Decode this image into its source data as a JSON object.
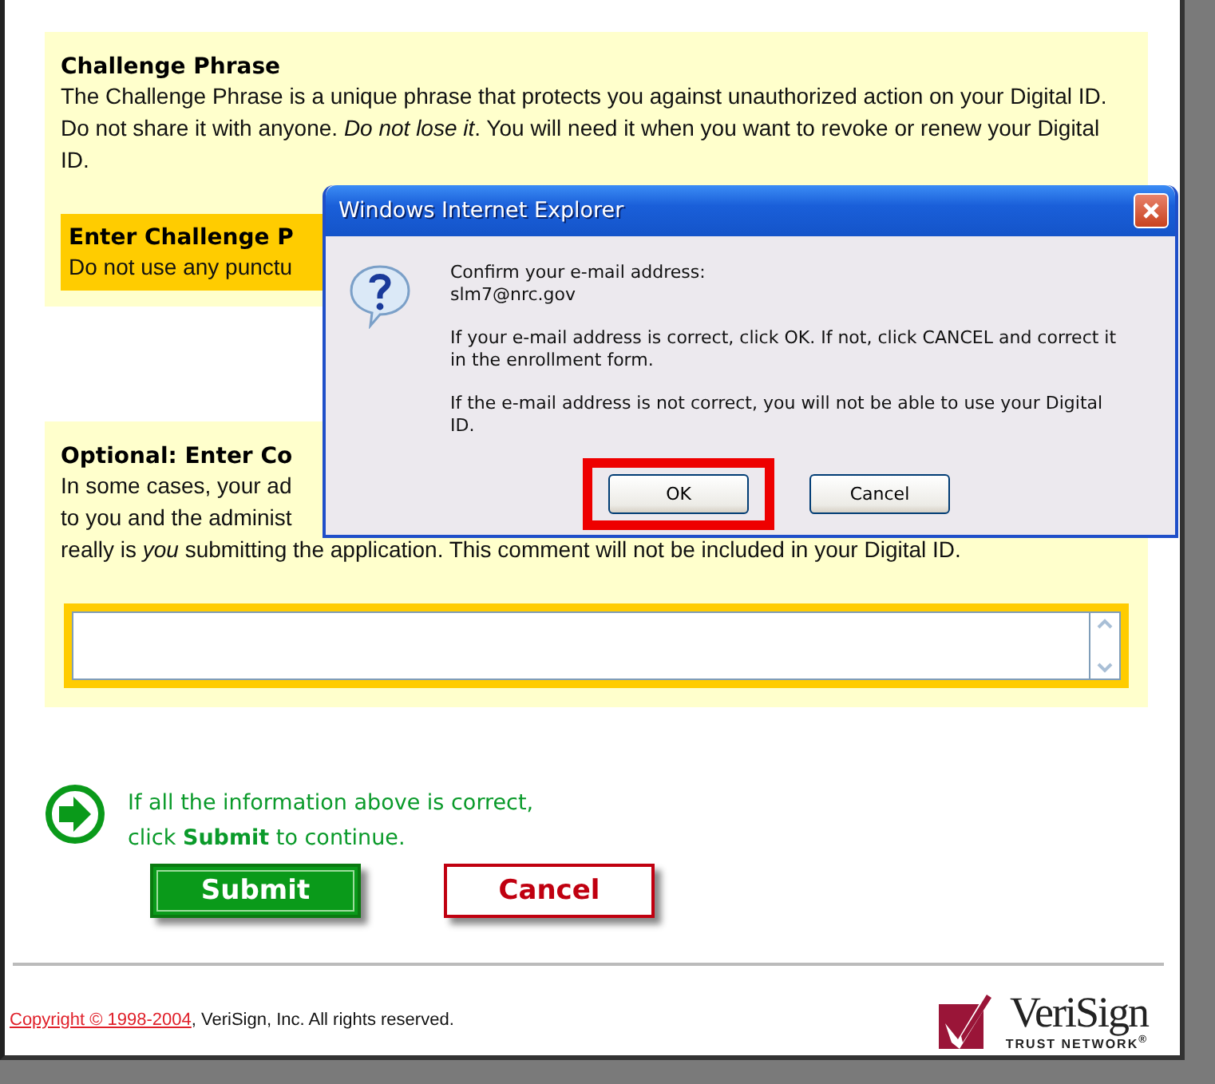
{
  "challenge": {
    "heading": "Challenge Phrase",
    "text": "The Challenge Phrase is a unique phrase that protects you against unauthorized action on your Digital ID. Do not share it with anyone. *Do not lose it*. You will need it when you want to revoke or renew your Digital ID.",
    "enter_heading": "Enter Challenge P",
    "enter_hint": "Do not use any punctu"
  },
  "comment": {
    "heading": "Optional: Enter Co",
    "lines": [
      "In some cases, your ad",
      "to you and the administ",
      "really is *you* submitting the application. This comment will not be included in your Digital ID."
    ]
  },
  "submit_note": [
    "If all the information above is correct,",
    "click **Submit** to continue."
  ],
  "buttons": [
    {
      "kind": "submit",
      "label": "Submit"
    },
    {
      "kind": "cancel",
      "label": "Cancel"
    }
  ],
  "footer": {
    "link": "Copyright © 1998-2004",
    "text": ", VeriSign, Inc. All rights reserved.",
    "logo_name": "VeriSign",
    "logo_tagline": "TRUST NETWORK$^{®}$"
  },
  "dialog": {
    "title": "Windows Internet Explorer",
    "prompt": "Confirm your e-mail address:",
    "email": "slm7@nrc.gov",
    "paragraphs": [
      "If your e-mail address is correct, click OK. If not, click CANCEL and correct it in the enrollment form.",
      "If the e-mail address is not correct, you will not be able to use your Digital ID."
    ],
    "buttons": [
      {
        "label": "OK",
        "highlighted": true
      },
      {
        "label": "Cancel",
        "highlighted": false
      }
    ]
  }
}
